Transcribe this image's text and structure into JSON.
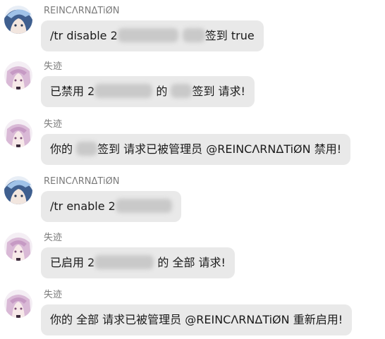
{
  "messages": [
    {
      "sender": "REINCΛRNΔTiØN",
      "avatar": "anime-blue-avatar",
      "parts": [
        "/tr disable 2",
        "签到 true"
      ]
    },
    {
      "sender": "失迹",
      "avatar": "anime-pink-avatar",
      "parts": [
        "已禁用 2",
        " 的 ",
        "签到 请求!"
      ]
    },
    {
      "sender": "失迹",
      "avatar": "anime-pink-avatar",
      "parts": [
        "你的 ",
        "签到 请求已被管理员 @REINCΛRNΔTiØN 禁用!"
      ]
    },
    {
      "sender": "REINCΛRNΔTiØN",
      "avatar": "anime-blue-avatar",
      "parts": [
        "/tr enable 2"
      ]
    },
    {
      "sender": "失迹",
      "avatar": "anime-pink-avatar",
      "parts": [
        "已启用 2",
        " 的 全部 请求!"
      ]
    },
    {
      "sender": "失迹",
      "avatar": "anime-pink-avatar",
      "parts": [
        "你的 全部 请求已被管理员 @REINCΛRNΔTiØN 重新启用!"
      ]
    }
  ]
}
